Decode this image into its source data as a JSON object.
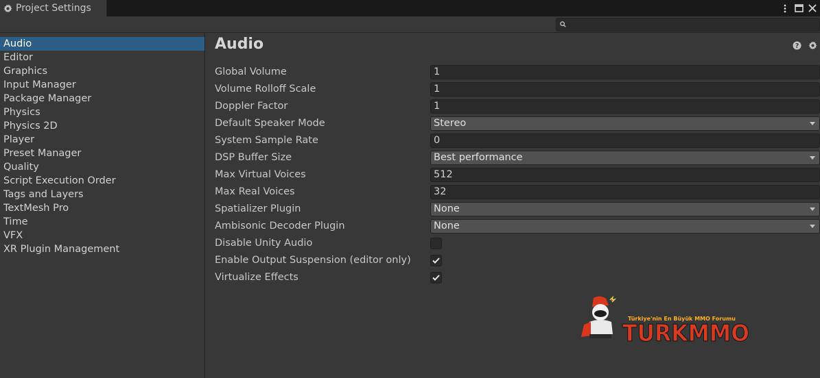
{
  "window": {
    "tab_title": "Project Settings",
    "controls": [
      "more-icon",
      "maximize-icon",
      "close-icon"
    ]
  },
  "search": {
    "value": "",
    "placeholder": ""
  },
  "sidebar": {
    "selected": "Audio",
    "items": [
      {
        "label": "Audio"
      },
      {
        "label": "Editor"
      },
      {
        "label": "Graphics"
      },
      {
        "label": "Input Manager"
      },
      {
        "label": "Package Manager"
      },
      {
        "label": "Physics"
      },
      {
        "label": "Physics 2D"
      },
      {
        "label": "Player"
      },
      {
        "label": "Preset Manager"
      },
      {
        "label": "Quality"
      },
      {
        "label": "Script Execution Order"
      },
      {
        "label": "Tags and Layers"
      },
      {
        "label": "TextMesh Pro"
      },
      {
        "label": "Time"
      },
      {
        "label": "VFX"
      },
      {
        "label": "XR Plugin Management"
      }
    ]
  },
  "main": {
    "title": "Audio",
    "fields": {
      "global_volume": {
        "label": "Global Volume",
        "value": "1"
      },
      "volume_rolloff_scale": {
        "label": "Volume Rolloff Scale",
        "value": "1"
      },
      "doppler_factor": {
        "label": "Doppler Factor",
        "value": "1"
      },
      "default_speaker_mode": {
        "label": "Default Speaker Mode",
        "value": "Stereo"
      },
      "system_sample_rate": {
        "label": "System Sample Rate",
        "value": "0"
      },
      "dsp_buffer_size": {
        "label": "DSP Buffer Size",
        "value": "Best performance"
      },
      "max_virtual_voices": {
        "label": "Max Virtual Voices",
        "value": "512"
      },
      "max_real_voices": {
        "label": "Max Real Voices",
        "value": "32"
      },
      "spatializer_plugin": {
        "label": "Spatializer Plugin",
        "value": "None"
      },
      "ambisonic_decoder_plugin": {
        "label": "Ambisonic Decoder Plugin",
        "value": "None"
      },
      "disable_unity_audio": {
        "label": "Disable Unity Audio",
        "checked": false
      },
      "enable_output_suspension": {
        "label": "Enable Output Suspension (editor only)",
        "checked": true
      },
      "virtualize_effects": {
        "label": "Virtualize Effects",
        "checked": true
      }
    }
  },
  "watermark": {
    "brand": "TURKMMO",
    "tagline": "Türkiye'nin En Büyük MMO Forumu"
  },
  "colors": {
    "background": "#383838",
    "selection": "#2c5d87",
    "field_bg": "#2a2a2a",
    "dropdown_bg": "#515151",
    "titlebar": "#191919"
  }
}
